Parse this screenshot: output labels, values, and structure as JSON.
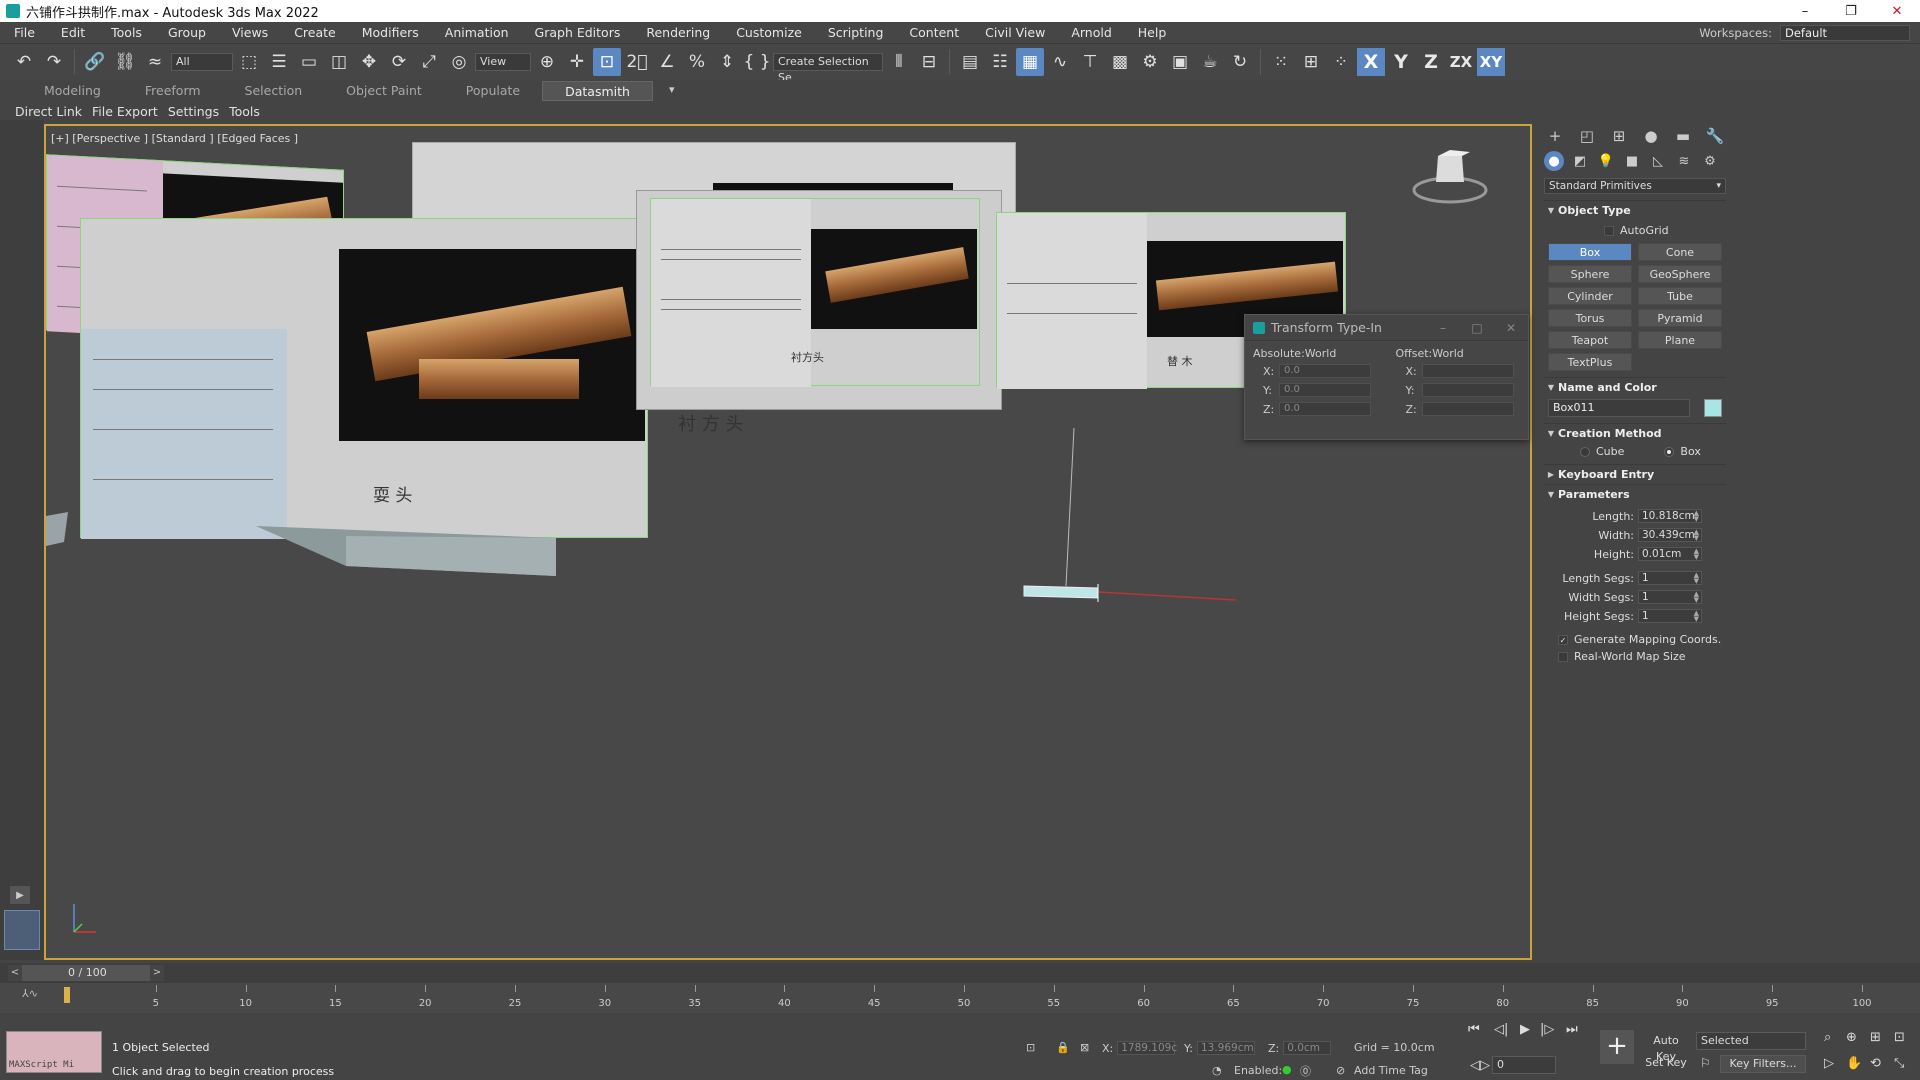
{
  "window": {
    "title": "六铺作斗拱制作.max - Autodesk 3ds Max 2022",
    "minimize": "–",
    "restore": "❐",
    "close": "✕"
  },
  "menu": [
    "File",
    "Edit",
    "Tools",
    "Group",
    "Views",
    "Create",
    "Modifiers",
    "Animation",
    "Graph Editors",
    "Rendering",
    "Customize",
    "Scripting",
    "Content",
    "Civil View",
    "Arnold",
    "Help"
  ],
  "workspace": {
    "label": "Workspaces:",
    "value": "Default"
  },
  "toolbar": {
    "selection_filter": "All",
    "ref_coord": "View",
    "named_selection": "Create Selection Se",
    "axis_x": "X",
    "axis_y": "Y",
    "axis_z": "Z",
    "axis_zx": "ZX",
    "axis_xy": "XY"
  },
  "ribbon": {
    "tabs": [
      "Modeling",
      "Freeform",
      "Selection",
      "Object Paint",
      "Populate",
      "Datasmith"
    ],
    "active": "Datasmith"
  },
  "subbar": [
    "Direct Link",
    "File Export",
    "Settings",
    "Tools"
  ],
  "viewport": {
    "label": "[+] [Perspective ] [Standard ] [Edged Faces ]",
    "captions": [
      "耍 头",
      "衬方头",
      "衬 方 头",
      "替 木",
      "耍 头"
    ]
  },
  "transform_dialog": {
    "title": "Transform Type-In",
    "absolute_label": "Absolute:World",
    "offset_label": "Offset:World",
    "abs": {
      "x": "0.0",
      "y": "0.0",
      "z": "0.0"
    },
    "offset": {
      "x": "",
      "y": "",
      "z": ""
    },
    "labels": {
      "x": "X:",
      "y": "Y:",
      "z": "Z:"
    }
  },
  "command_panel": {
    "category": "Standard Primitives",
    "object_type": {
      "title": "Object Type",
      "autogrid": "AutoGrid",
      "buttons": [
        "Box",
        "Cone",
        "Sphere",
        "GeoSphere",
        "Cylinder",
        "Tube",
        "Torus",
        "Pyramid",
        "Teapot",
        "Plane",
        "TextPlus"
      ],
      "active": "Box"
    },
    "name_and_color": {
      "title": "Name and Color",
      "name": "Box011",
      "color": "#a8e6e6"
    },
    "creation_method": {
      "title": "Creation Method",
      "options": [
        "Cube",
        "Box"
      ],
      "selected": "Box"
    },
    "keyboard_entry": "Keyboard Entry",
    "parameters": {
      "title": "Parameters",
      "rows": [
        {
          "label": "Length:",
          "value": "10.818cm"
        },
        {
          "label": "Width:",
          "value": "30.439cm"
        },
        {
          "label": "Height:",
          "value": "0.01cm"
        },
        {
          "label": "Length Segs:",
          "value": "1"
        },
        {
          "label": "Width Segs:",
          "value": "1"
        },
        {
          "label": "Height Segs:",
          "value": "1"
        }
      ],
      "gen_mapping": "Generate Mapping Coords.",
      "real_world": "Real-World Map Size"
    }
  },
  "timeline": {
    "frame": "0 / 100",
    "ticks": [
      "5",
      "10",
      "15",
      "20",
      "25",
      "30",
      "35",
      "40",
      "45",
      "50",
      "55",
      "60",
      "65",
      "70",
      "75",
      "80",
      "85",
      "90",
      "95",
      "100"
    ]
  },
  "status": {
    "maxscript": "MAXScript Mi",
    "selected": "1 Object Selected",
    "prompt": "Click and drag to begin creation process",
    "x_label": "X:",
    "x_value": "1789.109c",
    "y_label": "Y:",
    "y_value": "13.969cm",
    "z_label": "Z:",
    "z_value": "0.0cm",
    "grid": "Grid = 10.0cm",
    "enabled": "Enabled:",
    "add_time_tag": "Add Time Tag",
    "auto_key": "Auto Key",
    "set_key": "Set Key",
    "selected_dropdown": "Selected",
    "key_filters": "Key Filters...",
    "frame_field": "0"
  }
}
